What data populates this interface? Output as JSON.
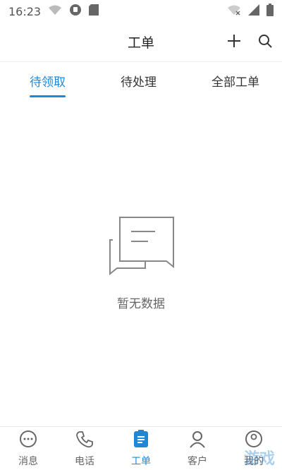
{
  "status_bar": {
    "time": "16:23"
  },
  "app_bar": {
    "title": "工单",
    "actions": [
      "plus-icon",
      "search-icon"
    ]
  },
  "tabs": [
    {
      "label": "待领取",
      "active": true
    },
    {
      "label": "待处理",
      "active": false
    },
    {
      "label": "全部工单",
      "active": false
    }
  ],
  "empty_state": {
    "icon": "chat-bubbles-icon",
    "message": "暂无数据"
  },
  "bottom_nav": [
    {
      "label": "消息",
      "icon": "chat-icon",
      "active": false
    },
    {
      "label": "电话",
      "icon": "phone-icon",
      "active": false
    },
    {
      "label": "工单",
      "icon": "clipboard-icon",
      "active": true
    },
    {
      "label": "客户",
      "icon": "user-icon",
      "active": false
    },
    {
      "label": "我的",
      "icon": "profile-icon",
      "active": false
    }
  ],
  "watermark": {
    "text": "游戏"
  },
  "colors": {
    "accent": "#1e88d6",
    "text": "#333333",
    "muted": "#666666"
  }
}
